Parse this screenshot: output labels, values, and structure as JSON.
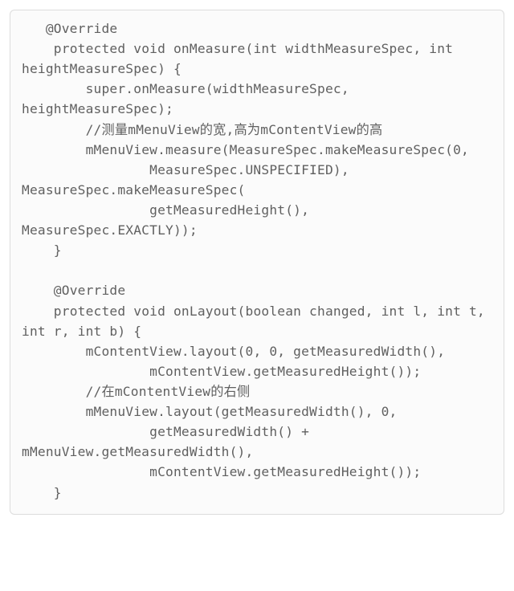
{
  "code": "   @Override\n    protected void onMeasure(int widthMeasureSpec, int heightMeasureSpec) {\n        super.onMeasure(widthMeasureSpec, heightMeasureSpec);\n        //测量mMenuView的宽,高为mContentView的高\n        mMenuView.measure(MeasureSpec.makeMeasureSpec(0,\n                MeasureSpec.UNSPECIFIED), MeasureSpec.makeMeasureSpec(\n                getMeasuredHeight(), MeasureSpec.EXACTLY));\n    }\n\n    @Override\n    protected void onLayout(boolean changed, int l, int t, int r, int b) {\n        mContentView.layout(0, 0, getMeasuredWidth(),\n                mContentView.getMeasuredHeight());\n        //在mContentView的右侧\n        mMenuView.layout(getMeasuredWidth(), 0,\n                getMeasuredWidth() + mMenuView.getMeasuredWidth(),\n                mContentView.getMeasuredHeight());\n    }"
}
